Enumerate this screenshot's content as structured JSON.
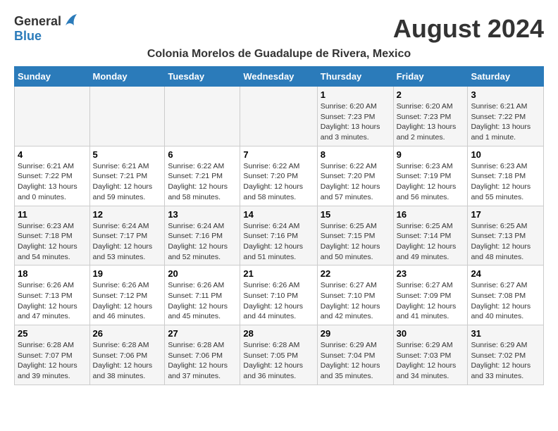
{
  "logo": {
    "general": "General",
    "blue": "Blue"
  },
  "title": "August 2024",
  "subtitle": "Colonia Morelos de Guadalupe de Rivera, Mexico",
  "days_of_week": [
    "Sunday",
    "Monday",
    "Tuesday",
    "Wednesday",
    "Thursday",
    "Friday",
    "Saturday"
  ],
  "weeks": [
    [
      {
        "day": "",
        "info": ""
      },
      {
        "day": "",
        "info": ""
      },
      {
        "day": "",
        "info": ""
      },
      {
        "day": "",
        "info": ""
      },
      {
        "day": "1",
        "info": "Sunrise: 6:20 AM\nSunset: 7:23 PM\nDaylight: 13 hours\nand 3 minutes."
      },
      {
        "day": "2",
        "info": "Sunrise: 6:20 AM\nSunset: 7:23 PM\nDaylight: 13 hours\nand 2 minutes."
      },
      {
        "day": "3",
        "info": "Sunrise: 6:21 AM\nSunset: 7:22 PM\nDaylight: 13 hours\nand 1 minute."
      }
    ],
    [
      {
        "day": "4",
        "info": "Sunrise: 6:21 AM\nSunset: 7:22 PM\nDaylight: 13 hours\nand 0 minutes."
      },
      {
        "day": "5",
        "info": "Sunrise: 6:21 AM\nSunset: 7:21 PM\nDaylight: 12 hours\nand 59 minutes."
      },
      {
        "day": "6",
        "info": "Sunrise: 6:22 AM\nSunset: 7:21 PM\nDaylight: 12 hours\nand 58 minutes."
      },
      {
        "day": "7",
        "info": "Sunrise: 6:22 AM\nSunset: 7:20 PM\nDaylight: 12 hours\nand 58 minutes."
      },
      {
        "day": "8",
        "info": "Sunrise: 6:22 AM\nSunset: 7:20 PM\nDaylight: 12 hours\nand 57 minutes."
      },
      {
        "day": "9",
        "info": "Sunrise: 6:23 AM\nSunset: 7:19 PM\nDaylight: 12 hours\nand 56 minutes."
      },
      {
        "day": "10",
        "info": "Sunrise: 6:23 AM\nSunset: 7:18 PM\nDaylight: 12 hours\nand 55 minutes."
      }
    ],
    [
      {
        "day": "11",
        "info": "Sunrise: 6:23 AM\nSunset: 7:18 PM\nDaylight: 12 hours\nand 54 minutes."
      },
      {
        "day": "12",
        "info": "Sunrise: 6:24 AM\nSunset: 7:17 PM\nDaylight: 12 hours\nand 53 minutes."
      },
      {
        "day": "13",
        "info": "Sunrise: 6:24 AM\nSunset: 7:16 PM\nDaylight: 12 hours\nand 52 minutes."
      },
      {
        "day": "14",
        "info": "Sunrise: 6:24 AM\nSunset: 7:16 PM\nDaylight: 12 hours\nand 51 minutes."
      },
      {
        "day": "15",
        "info": "Sunrise: 6:25 AM\nSunset: 7:15 PM\nDaylight: 12 hours\nand 50 minutes."
      },
      {
        "day": "16",
        "info": "Sunrise: 6:25 AM\nSunset: 7:14 PM\nDaylight: 12 hours\nand 49 minutes."
      },
      {
        "day": "17",
        "info": "Sunrise: 6:25 AM\nSunset: 7:13 PM\nDaylight: 12 hours\nand 48 minutes."
      }
    ],
    [
      {
        "day": "18",
        "info": "Sunrise: 6:26 AM\nSunset: 7:13 PM\nDaylight: 12 hours\nand 47 minutes."
      },
      {
        "day": "19",
        "info": "Sunrise: 6:26 AM\nSunset: 7:12 PM\nDaylight: 12 hours\nand 46 minutes."
      },
      {
        "day": "20",
        "info": "Sunrise: 6:26 AM\nSunset: 7:11 PM\nDaylight: 12 hours\nand 45 minutes."
      },
      {
        "day": "21",
        "info": "Sunrise: 6:26 AM\nSunset: 7:10 PM\nDaylight: 12 hours\nand 44 minutes."
      },
      {
        "day": "22",
        "info": "Sunrise: 6:27 AM\nSunset: 7:10 PM\nDaylight: 12 hours\nand 42 minutes."
      },
      {
        "day": "23",
        "info": "Sunrise: 6:27 AM\nSunset: 7:09 PM\nDaylight: 12 hours\nand 41 minutes."
      },
      {
        "day": "24",
        "info": "Sunrise: 6:27 AM\nSunset: 7:08 PM\nDaylight: 12 hours\nand 40 minutes."
      }
    ],
    [
      {
        "day": "25",
        "info": "Sunrise: 6:28 AM\nSunset: 7:07 PM\nDaylight: 12 hours\nand 39 minutes."
      },
      {
        "day": "26",
        "info": "Sunrise: 6:28 AM\nSunset: 7:06 PM\nDaylight: 12 hours\nand 38 minutes."
      },
      {
        "day": "27",
        "info": "Sunrise: 6:28 AM\nSunset: 7:06 PM\nDaylight: 12 hours\nand 37 minutes."
      },
      {
        "day": "28",
        "info": "Sunrise: 6:28 AM\nSunset: 7:05 PM\nDaylight: 12 hours\nand 36 minutes."
      },
      {
        "day": "29",
        "info": "Sunrise: 6:29 AM\nSunset: 7:04 PM\nDaylight: 12 hours\nand 35 minutes."
      },
      {
        "day": "30",
        "info": "Sunrise: 6:29 AM\nSunset: 7:03 PM\nDaylight: 12 hours\nand 34 minutes."
      },
      {
        "day": "31",
        "info": "Sunrise: 6:29 AM\nSunset: 7:02 PM\nDaylight: 12 hours\nand 33 minutes."
      }
    ]
  ]
}
